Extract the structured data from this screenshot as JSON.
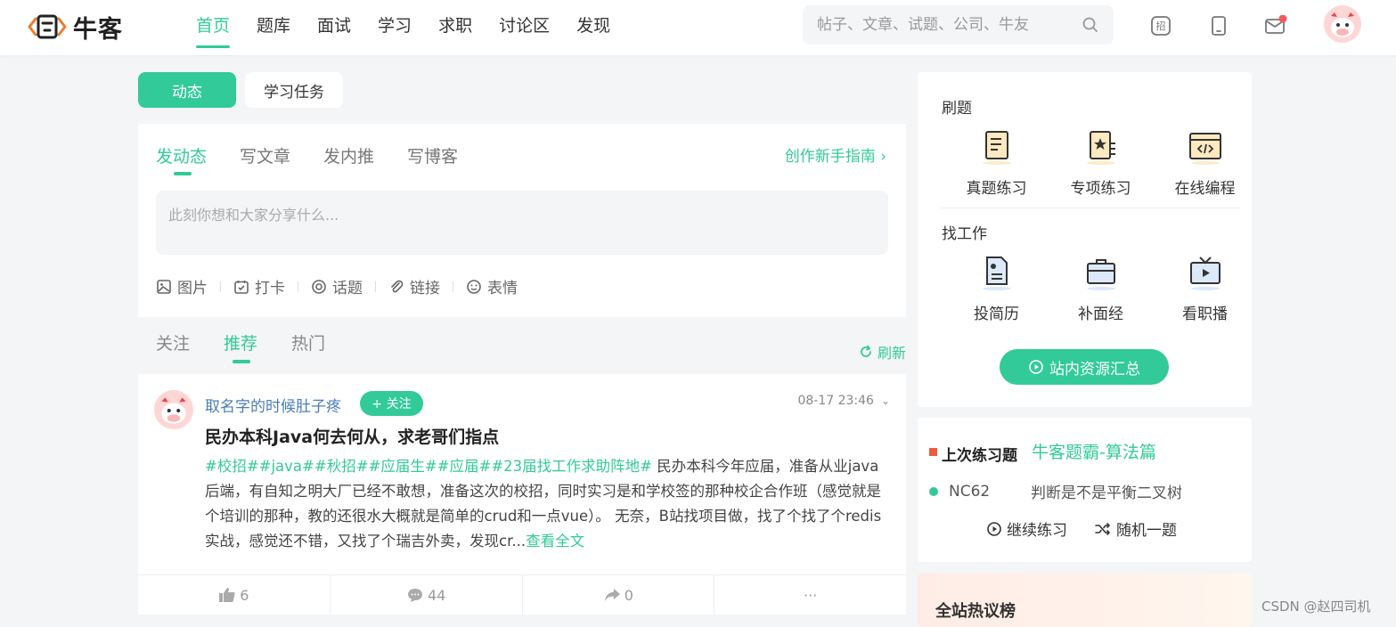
{
  "brand": {
    "name": "牛客"
  },
  "nav": {
    "items": [
      "首页",
      "题库",
      "面试",
      "学习",
      "求职",
      "讨论区",
      "发现"
    ],
    "active_index": 0
  },
  "search": {
    "placeholder": "帖子、文章、试题、公司、牛友"
  },
  "header_icons": {
    "recruit_glyph": "招"
  },
  "main_tabs": {
    "active": "动态",
    "other": "学习任务"
  },
  "composer": {
    "tabs": [
      "发动态",
      "写文章",
      "发内推",
      "写博客"
    ],
    "guide": "创作新手指南",
    "placeholder": "此刻你想和大家分享什么...",
    "tools": [
      "图片",
      "打卡",
      "话题",
      "链接",
      "表情"
    ]
  },
  "feed": {
    "tabs": [
      "关注",
      "推荐",
      "热门"
    ],
    "active_index": 1,
    "refresh": "刷新"
  },
  "post": {
    "author": "取名字的时候肚子疼",
    "follow": "+ 关注",
    "time": "08-17 23:46",
    "title": "民办本科Java何去何从，求老哥们指点",
    "tags": "#校招##java##秋招##应届生##应届##23届找工作求助阵地#",
    "body": " 民办本科今年应届，准备从业java后端，有自知之明大厂已经不敢想，准备这次的校招，同时实习是和学校签的那种校企合作班（感觉就是个培训的那种，教的还很水大概就是简单的crud和一点vue）。  无奈，B站找项目做，找了个找了个redis实战，感觉还不错，又找了个瑞吉外卖，发现cr...",
    "read_more": "查看全文",
    "likes": "6",
    "comments": "44",
    "shares": "0",
    "more": "···"
  },
  "practice": {
    "title": "刷题",
    "items": [
      "真题练习",
      "专项练习",
      "在线编程"
    ],
    "job_title": "找工作",
    "job_items": [
      "投简历",
      "补面经",
      "看职播"
    ],
    "resources": "站内资源汇总"
  },
  "last_practice": {
    "label": "上次练习题",
    "link": "牛客题霸-算法篇",
    "id": "NC62",
    "name": "判断是不是平衡二叉树",
    "continue": "继续练习",
    "random": "随机一题"
  },
  "hot": {
    "title": "全站热议榜"
  },
  "watermark": "CSDN @赵四司机",
  "colors": {
    "accent": "#32ca99",
    "link_blue": "#4a7db8",
    "orange": "#f05a3c"
  }
}
